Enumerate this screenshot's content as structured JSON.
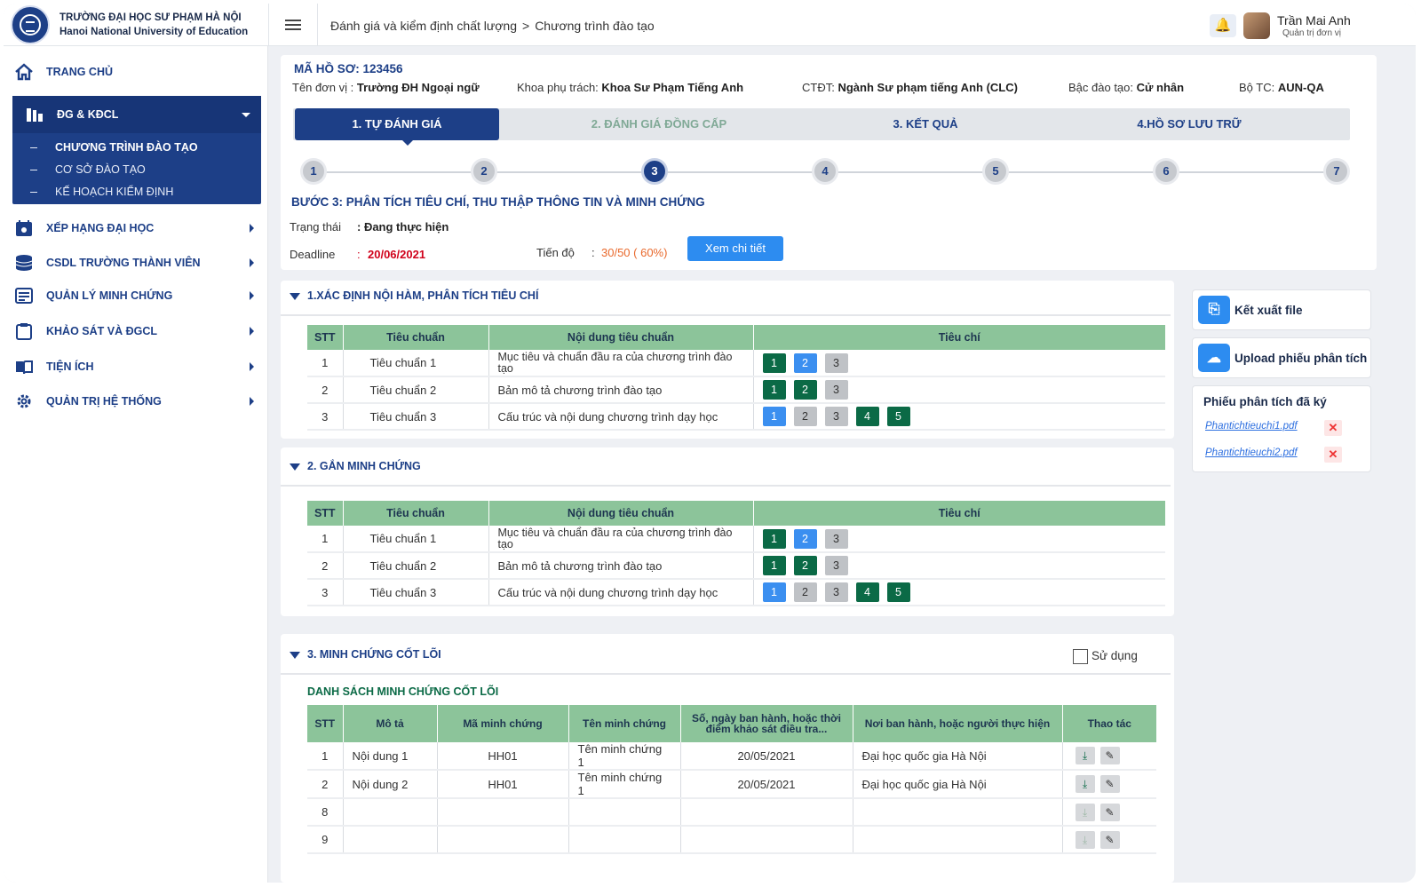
{
  "app": {
    "brand_line1": "TRƯỜNG ĐẠI HỌC SƯ PHẠM HÀ NỘI",
    "brand_line2": "Hanoi National University of Education",
    "breadcrumb": [
      "Đánh giá và kiểm định chất lượng",
      "Chương trình đào tạo"
    ],
    "breadcrumb_sep": ">",
    "user_name": "Trần Mai Anh",
    "user_role": "Quản trị đơn vị"
  },
  "sidebar": {
    "home": "TRANG CHỦ",
    "active_group": "ĐG & KĐCL",
    "sub_items": [
      "CHƯƠNG TRÌNH ĐÀO TẠO",
      "CƠ SỞ ĐÀO TẠO",
      "KẾ HOẠCH KIỂM ĐỊNH"
    ],
    "items": [
      "XẾP HẠNG ĐẠI HỌC",
      "CSDL TRƯỜNG THÀNH VIÊN",
      "QUẢN LÝ MINH CHỨNG",
      "KHẢO SÁT VÀ  ĐGCL",
      "TIỆN ÍCH",
      "QUẢN TRỊ HỆ THỐNG"
    ]
  },
  "profile": {
    "code": "MÃ HỒ SƠ: 123456",
    "unit_label": "Tên đơn vị :",
    "unit_value": "Trường ĐH Ngoại ngữ",
    "faculty_label": "Khoa phụ trách:",
    "faculty_value": "Khoa Sư Phạm Tiếng Anh",
    "program_label": "CTĐT:",
    "program_value": "Ngành Sư phạm tiếng Anh (CLC)",
    "level_label": "Bậc đào tạo:",
    "level_value": "Cử nhân",
    "standard_label": "Bộ TC:",
    "standard_value": "AUN-QA"
  },
  "tabs": [
    "1. TỰ ĐÁNH GIÁ",
    "2. ĐÁNH GIÁ ĐỒNG CẤP",
    "3. KẾT QUẢ",
    "4.HỒ SƠ LƯU TRỮ"
  ],
  "steps": [
    "1",
    "2",
    "3",
    "4",
    "5",
    "6",
    "7"
  ],
  "current_step": 3,
  "step_info": {
    "title": "BƯỚC 3: PHÂN TÍCH TIÊU CHÍ, THU THẬP THÔNG TIN VÀ MINH CHỨNG",
    "status_label": "Trạng thái",
    "status_value": ": Đang thực hiện",
    "deadline_label": "Deadline",
    "deadline_colon": ":",
    "deadline_value": "20/06/2021",
    "progress_label": "Tiến độ",
    "progress_colon": ":",
    "progress_value": "30/50 ( 60%)",
    "detail_button": "Xem chi tiết"
  },
  "criteria_table": {
    "headers": [
      "STT",
      "Tiêu chuẩn",
      "Nội dung tiêu chuẩn",
      "Tiêu chí"
    ],
    "rows": [
      {
        "stt": "1",
        "standard": "Tiêu chuẩn 1",
        "content": "Mục tiêu và chuẩn đầu ra của chương trình đào tạo",
        "chips": [
          {
            "n": "1",
            "c": "d"
          },
          {
            "n": "2",
            "c": "b"
          },
          {
            "n": "3",
            "c": "g"
          }
        ]
      },
      {
        "stt": "2",
        "standard": "Tiêu chuẩn 2",
        "content": "Bản mô tả chương trình đào tạo",
        "chips": [
          {
            "n": "1",
            "c": "d"
          },
          {
            "n": "2",
            "c": "d"
          },
          {
            "n": "3",
            "c": "g"
          }
        ]
      },
      {
        "stt": "3",
        "standard": "Tiêu chuẩn 3",
        "content": "Cấu trúc và nội dung chương trình dạy học",
        "chips": [
          {
            "n": "1",
            "c": "b"
          },
          {
            "n": "2",
            "c": "g"
          },
          {
            "n": "3",
            "c": "g"
          },
          {
            "n": "4",
            "c": "d"
          },
          {
            "n": "5",
            "c": "d"
          }
        ]
      }
    ]
  },
  "sections": {
    "s1": "1.XÁC ĐỊNH NỘI HÀM, PHÂN TÍCH TIÊU CHÍ",
    "s2": "2. GẮN MINH CHỨNG",
    "s3": "3. MINH CHỨNG CỐT LÕI",
    "use_label": "Sử dụng",
    "list_title": "DANH SÁCH MINH CHỨNG CỐT LÕI"
  },
  "evidence_table": {
    "headers": [
      "STT",
      "Mô tả",
      "Mã minh chứng",
      "Tên minh chứng",
      "Số, ngày ban hành, hoặc thời điểm khảo sát điều tra...",
      "Nơi ban hành, hoặc người thực hiện",
      "Thao tác"
    ],
    "rows": [
      {
        "stt": "1",
        "desc": "Nội dung 1",
        "code": "HH01",
        "name": "Tên minh chứng 1",
        "date": "20/05/2021",
        "issuer": "Đại học quốc gia Hà Nội"
      },
      {
        "stt": "2",
        "desc": "Nội dung 2",
        "code": "HH01",
        "name": "Tên minh chứng 1",
        "date": "20/05/2021",
        "issuer": "Đại học quốc gia Hà Nội"
      },
      {
        "stt": "8",
        "desc": "",
        "code": "",
        "name": "",
        "date": "",
        "issuer": ""
      },
      {
        "stt": "9",
        "desc": "",
        "code": "",
        "name": "",
        "date": "",
        "issuer": ""
      }
    ]
  },
  "right_panel": {
    "export_button": "Kết xuất file",
    "upload_button": "Upload phiếu phân tích",
    "files_title": "Phiếu phân tích đã ký",
    "files": [
      "Phantichtieuchi1.pdf",
      "Phantichtieuchi2.pdf"
    ],
    "remove_glyph": "✕"
  },
  "colors": {
    "primary": "#1d3f87",
    "table_header": "#8cc49a",
    "deadline": "#d0021b",
    "progress": "#e9692c",
    "button": "#2d8cf0"
  }
}
